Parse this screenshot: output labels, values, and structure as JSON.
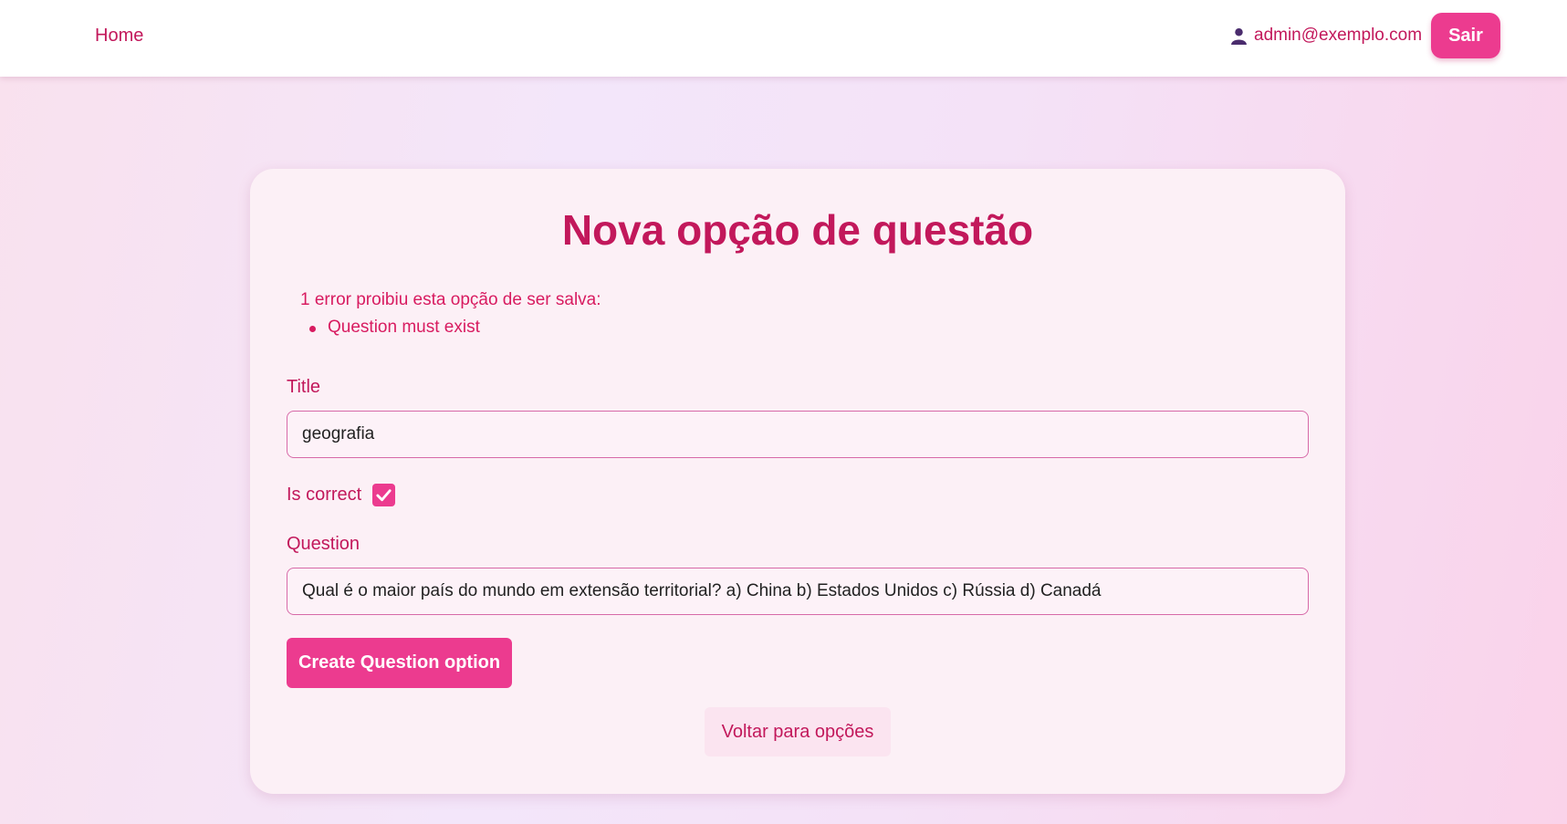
{
  "nav": {
    "home_label": "Home",
    "user_email": "admin@exemplo.com",
    "logout_label": "Sair"
  },
  "form": {
    "title": "Nova opção de questão",
    "error_header": "1 error proibiu esta opção de ser salva:",
    "errors": [
      "Question must exist"
    ],
    "title_label": "Title",
    "title_value": "geografia",
    "is_correct_label": "Is correct",
    "is_correct_checked": true,
    "question_label": "Question",
    "question_value": "Qual é o maior país do mundo em extensão territorial?  a) China b) Estados Unidos c) Rússia d) Canadá",
    "submit_label": "Create Question option",
    "back_label": "Voltar para opções"
  },
  "colors": {
    "accent": "#ec3b8f",
    "text_primary": "#c2185b",
    "card_bg": "#fcf0f6"
  }
}
